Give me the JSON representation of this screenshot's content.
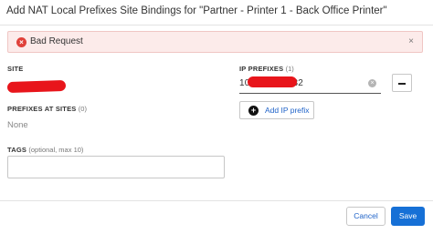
{
  "dialog": {
    "title": "Add NAT Local Prefixes Site Bindings for \"Partner - Printer 1 - Back Office Printer\""
  },
  "alert": {
    "message": "Bad Request",
    "icon": "error-circle-icon",
    "close_symbol": "×"
  },
  "site": {
    "label": "SITE",
    "value_redacted": true
  },
  "prefixes_at_sites": {
    "label": "PREFIXES AT SITES",
    "count": "(0)",
    "value": "None"
  },
  "tags": {
    "label": "TAGS",
    "hint": "(optional, max 10)",
    "value": ""
  },
  "ip_prefixes": {
    "label": "IP PREFIXES",
    "count": "(1)",
    "entries": [
      {
        "prefix_start": "10",
        "prefix_end": "32"
      }
    ],
    "add_label": "Add IP prefix"
  },
  "footer": {
    "cancel_label": "Cancel",
    "save_label": "Save"
  },
  "colors": {
    "accent": "#1670d6",
    "link": "#1e62c8",
    "error": "#e0413a",
    "alert_bg": "#fcebea"
  }
}
